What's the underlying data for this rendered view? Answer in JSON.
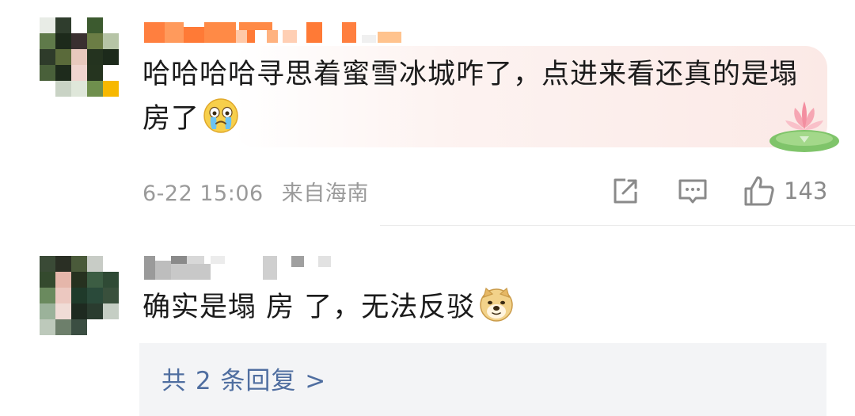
{
  "comments": [
    {
      "text": "哈哈哈哈寻思着蜜雪冰城咋了，点进来看还真的是塌房了",
      "emoji": "crying-face-emoji",
      "date": "6-22 15:06",
      "location": "来自海南",
      "like_count": "143",
      "icons": [
        "share-icon",
        "comment-icon",
        "like-icon"
      ]
    },
    {
      "text": "确实是塌 房 了，无法反驳",
      "emoji": "doge-emoji",
      "replies_label": "共 2 条回复 >"
    }
  ],
  "colors": {
    "text": "#1b1b1b",
    "meta": "#9a9a9a",
    "link": "#4f6ea0",
    "bubble": "#fbe9e6",
    "reply_box": "#f3f4f6"
  }
}
